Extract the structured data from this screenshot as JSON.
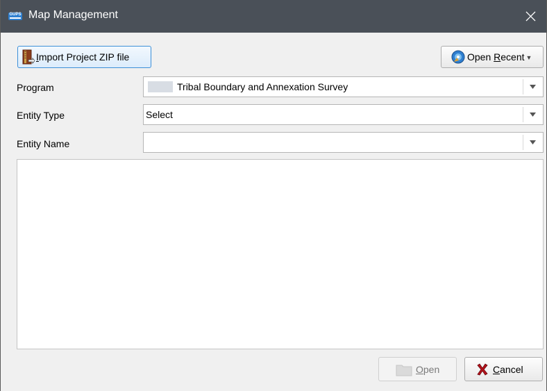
{
  "window": {
    "title": "Map Management",
    "app_icon_text": "GUPS"
  },
  "toolbar": {
    "import_label_prefix": "",
    "import_label_underline": "I",
    "import_label_rest": "mport Project ZIP file",
    "recent_label_prefix": "Open ",
    "recent_label_underline": "R",
    "recent_label_rest": "ecent"
  },
  "form": {
    "program_label": "Program",
    "program_value": "Tribal Boundary and Annexation Survey",
    "entity_type_label": "Entity Type",
    "entity_type_value": "Select",
    "entity_name_label": "Entity Name",
    "entity_name_value": ""
  },
  "footer": {
    "open_underline": "O",
    "open_rest": "pen",
    "cancel_underline": "C",
    "cancel_rest": "ancel"
  },
  "colors": {
    "titlebar": "#4a5058",
    "accent": "#3c8fd8",
    "cancel_icon": "#b5121b"
  },
  "icons": {
    "app": "gups-logo-icon",
    "close": "close-icon",
    "import": "zip-file-icon",
    "recent": "disc-icon",
    "open": "folder-icon",
    "cancel": "x-cancel-icon",
    "dropdown": "chevron-down-icon"
  }
}
